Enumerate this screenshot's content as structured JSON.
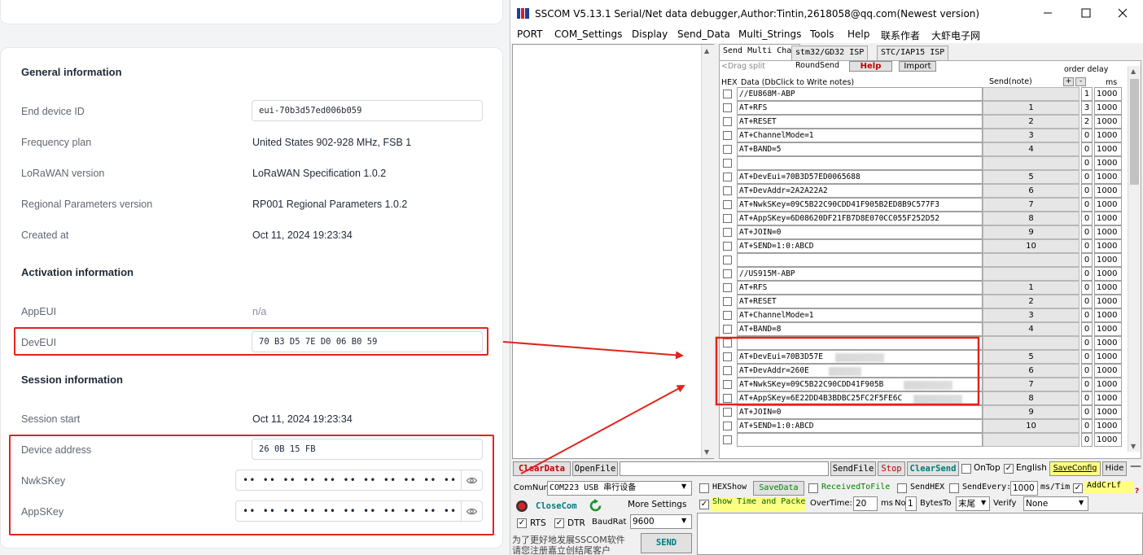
{
  "console": {
    "general": {
      "title": "General information",
      "rows": [
        {
          "label": "End device ID",
          "value": "eui-70b3d57ed006b059"
        },
        {
          "label": "Frequency plan",
          "value": "United States 902-928 MHz, FSB 1"
        },
        {
          "label": "LoRaWAN version",
          "value": "LoRaWAN Specification 1.0.2"
        },
        {
          "label": "Regional Parameters version",
          "value": "RP001 Regional Parameters 1.0.2"
        },
        {
          "label": "Created at",
          "value": "Oct 11, 2024 19:23:34"
        }
      ]
    },
    "activation": {
      "title": "Activation information",
      "appeui_label": "AppEUI",
      "appeui_value": "n/a",
      "deveui_label": "DevEUI",
      "deveui_value": "70 B3 D5 7E D0 06 B0 59"
    },
    "session": {
      "title": "Session information",
      "start_label": "Session start",
      "start_value": "Oct 11, 2024 19:23:34",
      "devaddr_label": "Device address",
      "devaddr_value": "26 0B 15 FB",
      "nwkskey_label": "NwkSKey",
      "nwkskey_value": "•• •• •• •• •• •• •• •• •• •• •• •• •• •• •• ••",
      "appskey_label": "AppSKey",
      "appskey_value": "•• •• •• •• •• •• •• •• •• •• •• •• •• •• •• ••"
    }
  },
  "sscom": {
    "title": "SSCOM V5.13.1 Serial/Net data debugger,Author:Tintin,2618058@qq.com(Newest version)",
    "menu": [
      "PORT",
      "COM_Settings",
      "Display",
      "Send_Data",
      "Multi_Strings",
      "Tools",
      "Help",
      "联系作者",
      "大虾电子网"
    ],
    "tabs": [
      "Send Multi Char",
      "stm32/GD32 ISP",
      "STC/IAP15 ISP"
    ],
    "toolbar": {
      "drag_split": "<Drag split",
      "round_send": "RoundSend",
      "help": "Help",
      "import": "Import",
      "order_delay": "order delay"
    },
    "header": {
      "hex": "HEX",
      "data": "Data (DbClick to Write notes)",
      "send": "Send(note)",
      "plus": "+",
      "minus": "-",
      "ms": "ms"
    },
    "rows": [
      {
        "cmd": "//EU868M-ABP",
        "note": "",
        "order": "1",
        "delay": "1000"
      },
      {
        "cmd": "AT+RFS",
        "note": "1",
        "order": "3",
        "delay": "1000"
      },
      {
        "cmd": "AT+RESET",
        "note": "2",
        "order": "2",
        "delay": "1000"
      },
      {
        "cmd": "AT+ChannelMode=1",
        "note": "3",
        "order": "0",
        "delay": "1000"
      },
      {
        "cmd": "AT+BAND=5",
        "note": "4",
        "order": "0",
        "delay": "1000"
      },
      {
        "cmd": "",
        "note": "",
        "order": "0",
        "delay": "1000"
      },
      {
        "cmd": "AT+DevEui=70B3D57ED0065688",
        "note": "5",
        "order": "0",
        "delay": "1000"
      },
      {
        "cmd": "AT+DevAddr=2A2A22A2",
        "note": "6",
        "order": "0",
        "delay": "1000"
      },
      {
        "cmd": "AT+NwkSKey=09C5B22C90CDD41F905B2ED8B9C577F3",
        "note": "7",
        "order": "0",
        "delay": "1000"
      },
      {
        "cmd": "AT+AppSKey=6D08620DF21FB7D8E070CC055F252D52",
        "note": "8",
        "order": "0",
        "delay": "1000"
      },
      {
        "cmd": "AT+JOIN=0",
        "note": "9",
        "order": "0",
        "delay": "1000"
      },
      {
        "cmd": "AT+SEND=1:0:ABCD",
        "note": "10",
        "order": "0",
        "delay": "1000"
      },
      {
        "cmd": "",
        "note": "",
        "order": "0",
        "delay": "1000"
      },
      {
        "cmd": "//US915M-ABP",
        "note": "",
        "order": "0",
        "delay": "1000"
      },
      {
        "cmd": "AT+RFS",
        "note": "1",
        "order": "0",
        "delay": "1000"
      },
      {
        "cmd": "AT+RESET",
        "note": "2",
        "order": "0",
        "delay": "1000"
      },
      {
        "cmd": "AT+ChannelMode=1",
        "note": "3",
        "order": "0",
        "delay": "1000"
      },
      {
        "cmd": "AT+BAND=8",
        "note": "4",
        "order": "0",
        "delay": "1000"
      },
      {
        "cmd": "",
        "note": "",
        "order": "0",
        "delay": "1000"
      },
      {
        "cmd": "AT+DevEui=70B3D57E",
        "note": "5",
        "order": "0",
        "delay": "1000"
      },
      {
        "cmd": "AT+DevAddr=260E",
        "note": "6",
        "order": "0",
        "delay": "1000"
      },
      {
        "cmd": "AT+NwkSKey=09C5B22C90CDD41F905B",
        "note": "7",
        "order": "0",
        "delay": "1000"
      },
      {
        "cmd": "AT+AppSKey=6E22DD4B3BDBC25FC2F5FE6C",
        "note": "8",
        "order": "0",
        "delay": "1000"
      },
      {
        "cmd": "AT+JOIN=0",
        "note": "9",
        "order": "0",
        "delay": "1000"
      },
      {
        "cmd": "AT+SEND=1:0:ABCD",
        "note": "10",
        "order": "0",
        "delay": "1000"
      },
      {
        "cmd": "",
        "note": "",
        "order": "0",
        "delay": "1000"
      }
    ],
    "bottom": {
      "clear_data": "ClearData",
      "open_file": "OpenFile",
      "send_file": "SendFile",
      "stop": "Stop",
      "clear_send": "ClearSend",
      "on_top": "OnTop",
      "english": "English",
      "save_config": "SaveConfig",
      "hide": "Hide",
      "comnum_label": "ComNum",
      "comnum_value": "COM223 USB 串行设备",
      "close_com": "CloseCom",
      "more_settings": "More Settings",
      "rts": "RTS",
      "dtr": "DTR",
      "baud_label": "BaudRat",
      "baud_value": "9600",
      "hex_show": "HEXShow",
      "save_data": "SaveData",
      "received_to_file": "ReceivedToFile",
      "send_hex": "SendHEX",
      "send_every": "SendEvery:",
      "send_every_value": "1000",
      "ms_tim": "ms/Tim",
      "add_crlf": "AddCrLf",
      "show_time": "Show Time and Packe",
      "overtime": "OverTime:",
      "overtime_value": "20",
      "ms": "ms",
      "no": "No",
      "no_value": "1",
      "bytes_to": "BytesTo",
      "bytes_to_value": "末尾",
      "verify": "Verify",
      "verify_value": "None",
      "promo1": "为了更好地发展SSCOM软件",
      "promo2": "请您注册嘉立创结尾客户",
      "send": "SEND",
      "question": "?"
    }
  },
  "colors": {
    "red": "#e0251c",
    "yellow": "#ffff80",
    "green": "#008000",
    "teal": "#007b7b"
  }
}
